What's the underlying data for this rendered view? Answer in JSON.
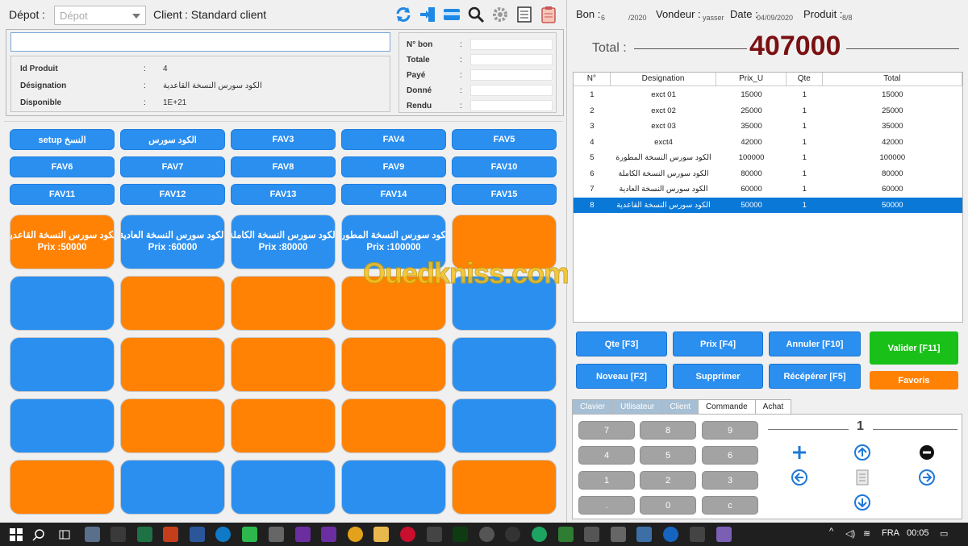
{
  "header": {
    "depot_label": "Dépot",
    "depot_colon": ":",
    "depot_placeholder": "Dépot",
    "client_label": "Client",
    "client_value": ": Standard client"
  },
  "product_info": {
    "id_label": "Id Produit",
    "id_value": "4",
    "designation_label": "Désignation",
    "designation_value": "الكود سورس النسخة القاعدية",
    "disponible_label": "Disponible",
    "disponible_value": "1E+21",
    "colon": ":"
  },
  "bon_info": {
    "rows": [
      {
        "label": "N° bon"
      },
      {
        "label": "Totale"
      },
      {
        "label": "Payé"
      },
      {
        "label": "Donné"
      },
      {
        "label": "Rendu"
      }
    ],
    "colon": ":"
  },
  "fav_buttons": [
    "setup النسخ",
    "الكود سورس",
    "FAV3",
    "FAV4",
    "FAV5",
    "FAV6",
    "FAV7",
    "FAV8",
    "FAV9",
    "FAV10",
    "FAV11",
    "FAV12",
    "FAV13",
    "FAV14",
    "FAV15"
  ],
  "product_buttons": [
    {
      "name": "الكود سورس النسخة القاعدية",
      "price": "Prix :50000",
      "color": "#ff8205"
    },
    {
      "name": "الكود سورس النسخة العادية",
      "price": "Prix :60000",
      "color": "#2b8ff0"
    },
    {
      "name": "الكود سورس النسخة الكاملة",
      "price": "Prix :80000",
      "color": "#2b8ff0"
    },
    {
      "name": "الكود سورس النسخة المطورة",
      "price": "Prix :100000",
      "color": "#2b8ff0"
    },
    {
      "name": "",
      "price": "",
      "color": "#ff8205"
    },
    {
      "name": "",
      "price": "",
      "color": "#2b8ff0"
    },
    {
      "name": "",
      "price": "",
      "color": "#ff8205"
    },
    {
      "name": "",
      "price": "",
      "color": "#ff8205"
    },
    {
      "name": "",
      "price": "",
      "color": "#ff8205"
    },
    {
      "name": "",
      "price": "",
      "color": "#2b8ff0"
    },
    {
      "name": "",
      "price": "",
      "color": "#2b8ff0"
    },
    {
      "name": "",
      "price": "",
      "color": "#ff8205"
    },
    {
      "name": "",
      "price": "",
      "color": "#ff8205"
    },
    {
      "name": "",
      "price": "",
      "color": "#ff8205"
    },
    {
      "name": "",
      "price": "",
      "color": "#2b8ff0"
    },
    {
      "name": "",
      "price": "",
      "color": "#2b8ff0"
    },
    {
      "name": "",
      "price": "",
      "color": "#ff8205"
    },
    {
      "name": "",
      "price": "",
      "color": "#ff8205"
    },
    {
      "name": "",
      "price": "",
      "color": "#ff8205"
    },
    {
      "name": "",
      "price": "",
      "color": "#2b8ff0"
    },
    {
      "name": "",
      "price": "",
      "color": "#ff8205"
    },
    {
      "name": "",
      "price": "",
      "color": "#2b8ff0"
    },
    {
      "name": "",
      "price": "",
      "color": "#2b8ff0"
    },
    {
      "name": "",
      "price": "",
      "color": "#2b8ff0"
    },
    {
      "name": "",
      "price": "",
      "color": "#ff8205"
    }
  ],
  "watermark": "Ouedkniss.com",
  "sale_header": {
    "bon_label": "Bon :",
    "bon_num": "6",
    "bon_year": "/2020",
    "vendeur_label": "Vondeur :",
    "vendeur_value": "yasser",
    "date_label": "Date :",
    "date_value": "04/09/2020",
    "produit_label": "Produit :",
    "produit_value": "8/8"
  },
  "total": {
    "label": "Total :",
    "value": "407000"
  },
  "sales_table": {
    "headers": [
      "N°",
      "Designation",
      "Prix_U",
      "Qte",
      "Total"
    ],
    "rows": [
      [
        "1",
        "exct 01",
        "15000",
        "1",
        "15000"
      ],
      [
        "2",
        "exct 02",
        "25000",
        "1",
        "25000"
      ],
      [
        "3",
        "exct 03",
        "35000",
        "1",
        "35000"
      ],
      [
        "4",
        "exct4",
        "42000",
        "1",
        "42000"
      ],
      [
        "5",
        "الكود سورس النسخة المطورة",
        "100000",
        "1",
        "100000"
      ],
      [
        "6",
        "الكود سورس النسخة الكاملة",
        "80000",
        "1",
        "80000"
      ],
      [
        "7",
        "الكود سورس النسخة العادية",
        "60000",
        "1",
        "60000"
      ],
      [
        "8",
        "الكود سورس النسخة القاعدية",
        "50000",
        "1",
        "50000"
      ]
    ],
    "selected_row": 8
  },
  "actions": {
    "qte": "Qte [F3]",
    "prix": "Prix [F4]",
    "annuler": "Annuler [F10]",
    "valider": "Valider [F11]",
    "nouveau": "Noveau [F2]",
    "supprimer": "Supprimer",
    "recuperer": "Récépérer [F5]",
    "favoris": "Favoris"
  },
  "tabs": [
    "Clavier",
    "Utlisateur",
    "Client",
    "Commande",
    "Achat"
  ],
  "keypad": [
    "7",
    "8",
    "9",
    "4",
    "5",
    "6",
    "1",
    "2",
    "3",
    ".",
    "0",
    "c"
  ],
  "quantity": "1",
  "taskbar": {
    "language": "FRA",
    "time": "00:05"
  },
  "colors": {
    "blue": "#2b8ff0",
    "orange": "#ff8205",
    "green": "#18c018",
    "total_red": "#7a1012",
    "selected_row": "#0a78d7"
  }
}
